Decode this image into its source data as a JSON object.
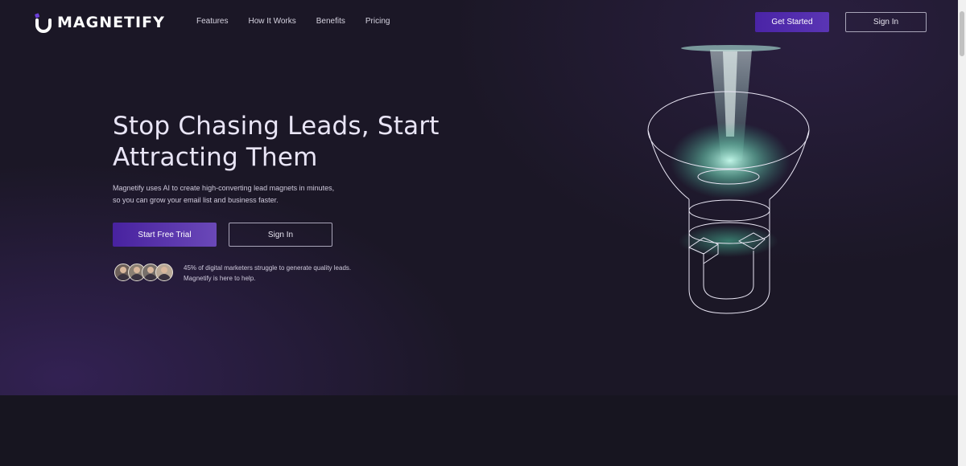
{
  "brand": {
    "name": "MAGNETIFY"
  },
  "nav": {
    "links": [
      "Features",
      "How It Works",
      "Benefits",
      "Pricing"
    ],
    "get_started": "Get Started",
    "sign_in": "Sign In"
  },
  "hero": {
    "headline_line1": "Stop Chasing Leads, Start",
    "headline_line2": "Attracting Them",
    "subtext_line1": "Magnetify uses AI to create high-converting lead magnets in minutes,",
    "subtext_line2": "so you can grow your email list and business faster.",
    "primary_cta": "Start Free Trial",
    "secondary_cta": "Sign In",
    "stat_line1": "45% of digital marketers struggle to generate quality leads.",
    "stat_line2": "Magnetify is here to help."
  },
  "colors": {
    "background": "#1b1726",
    "accent": "#4a24a6",
    "glow": "#7fe6c9"
  },
  "icons": [
    "magnet-logo-icon",
    "funnel-magnet-illustration"
  ]
}
